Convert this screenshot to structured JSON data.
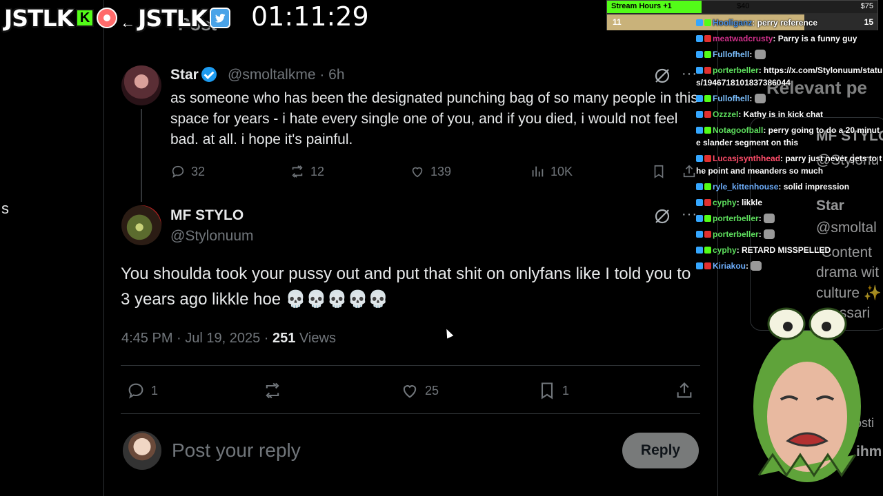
{
  "overlay": {
    "brand_left": "JSTLK",
    "kick_letter": "K",
    "brand_right": "JSTLK",
    "arrow": "←",
    "twitter_glyph": "🐦",
    "timer": "01:11:29",
    "page_title_ghost": "Post"
  },
  "stream_hours": {
    "label": "Stream Hours +1",
    "value_mid": "$40",
    "value_right": "$75",
    "progress_label": "11",
    "progress_right": "15",
    "top_fill_fraction": 0.35,
    "bottom_fill_fraction": 0.73
  },
  "left_rail": {
    "cut_text": "s"
  },
  "parent_tweet": {
    "name": "Star",
    "handle": "@smoltalkme",
    "time": "· 6h",
    "text": "as someone who has been the designated punching bag of so many people in this space for years - i hate every single one of you, and if you died, i would not feel bad. at all. i hope it's painful.",
    "replies": "32",
    "reposts": "12",
    "likes": "139",
    "views": "10K",
    "grok_icon": "grok-icon",
    "more_icon": "more-icon"
  },
  "main_tweet": {
    "name": "MF STYLO",
    "handle": "@Stylonuum",
    "text": "You shoulda took your pussy out and put that shit on onlyfans like I told you to 3 years ago likkle hoe",
    "skulls": "💀💀💀💀💀",
    "time": "4:45 PM · Jul 19, 2025 ·",
    "views_count": "251",
    "views_label": "Views",
    "replies": "1",
    "reposts": "",
    "likes": "25",
    "bookmarks": "1"
  },
  "reply_box": {
    "placeholder": "Post your reply",
    "button": "Reply"
  },
  "right_panel_ghost": {
    "title": "Relevant pe",
    "name1": "MF STYLO",
    "handle1": "@Stylonu",
    "name2": "Star",
    "handle2": "@smoltal",
    "quote1": "\"Content",
    "quote2": "drama wit",
    "quote3": "culture ✨",
    "quote4": "ecessari",
    "x_label": "X",
    "hosting": "is hosti",
    "ihm": "ihm"
  },
  "chat": [
    {
      "user": "Hooliganz",
      "color": "#4a90e2",
      "msg": ": perry reference"
    },
    {
      "user": "meatwadcrusty",
      "color": "#d0308a",
      "msg": ": Parry is a funny guy"
    },
    {
      "user": "Fullofhell",
      "color": "#7cc0ff",
      "msg": ": "
    },
    {
      "user": "porterbeller",
      "color": "#5ee05e",
      "msg": ": https://x.com/Stylonuum/status/1946718101837386044"
    },
    {
      "user": "Fullofhell",
      "color": "#7cc0ff",
      "msg": ": "
    },
    {
      "user": "Ozzzel",
      "color": "#5ee05e",
      "msg": ": Kathy is in kick chat"
    },
    {
      "user": "Notagoofball",
      "color": "#5ee05e",
      "msg": ": perry going to do a 20 minute slander segment on this"
    },
    {
      "user": "Lucasjsynthhead",
      "color": "#ff4d6a",
      "msg": ": parry just never gets to the point and meanders so much"
    },
    {
      "user": "ryle_kittenhouse",
      "color": "#6fb0ff",
      "msg": ": solid impression"
    },
    {
      "user": "cyphy",
      "color": "#5ee05e",
      "msg": ": likkle"
    },
    {
      "user": "porterbeller",
      "color": "#5ee05e",
      "msg": ": "
    },
    {
      "user": "porterbeller",
      "color": "#5ee05e",
      "msg": ": "
    },
    {
      "user": "cyphy",
      "color": "#5ee05e",
      "msg": ": RETARD MISSPELLED"
    },
    {
      "user": "Kiriakou",
      "color": "#6fb0ff",
      "msg": ": "
    }
  ]
}
